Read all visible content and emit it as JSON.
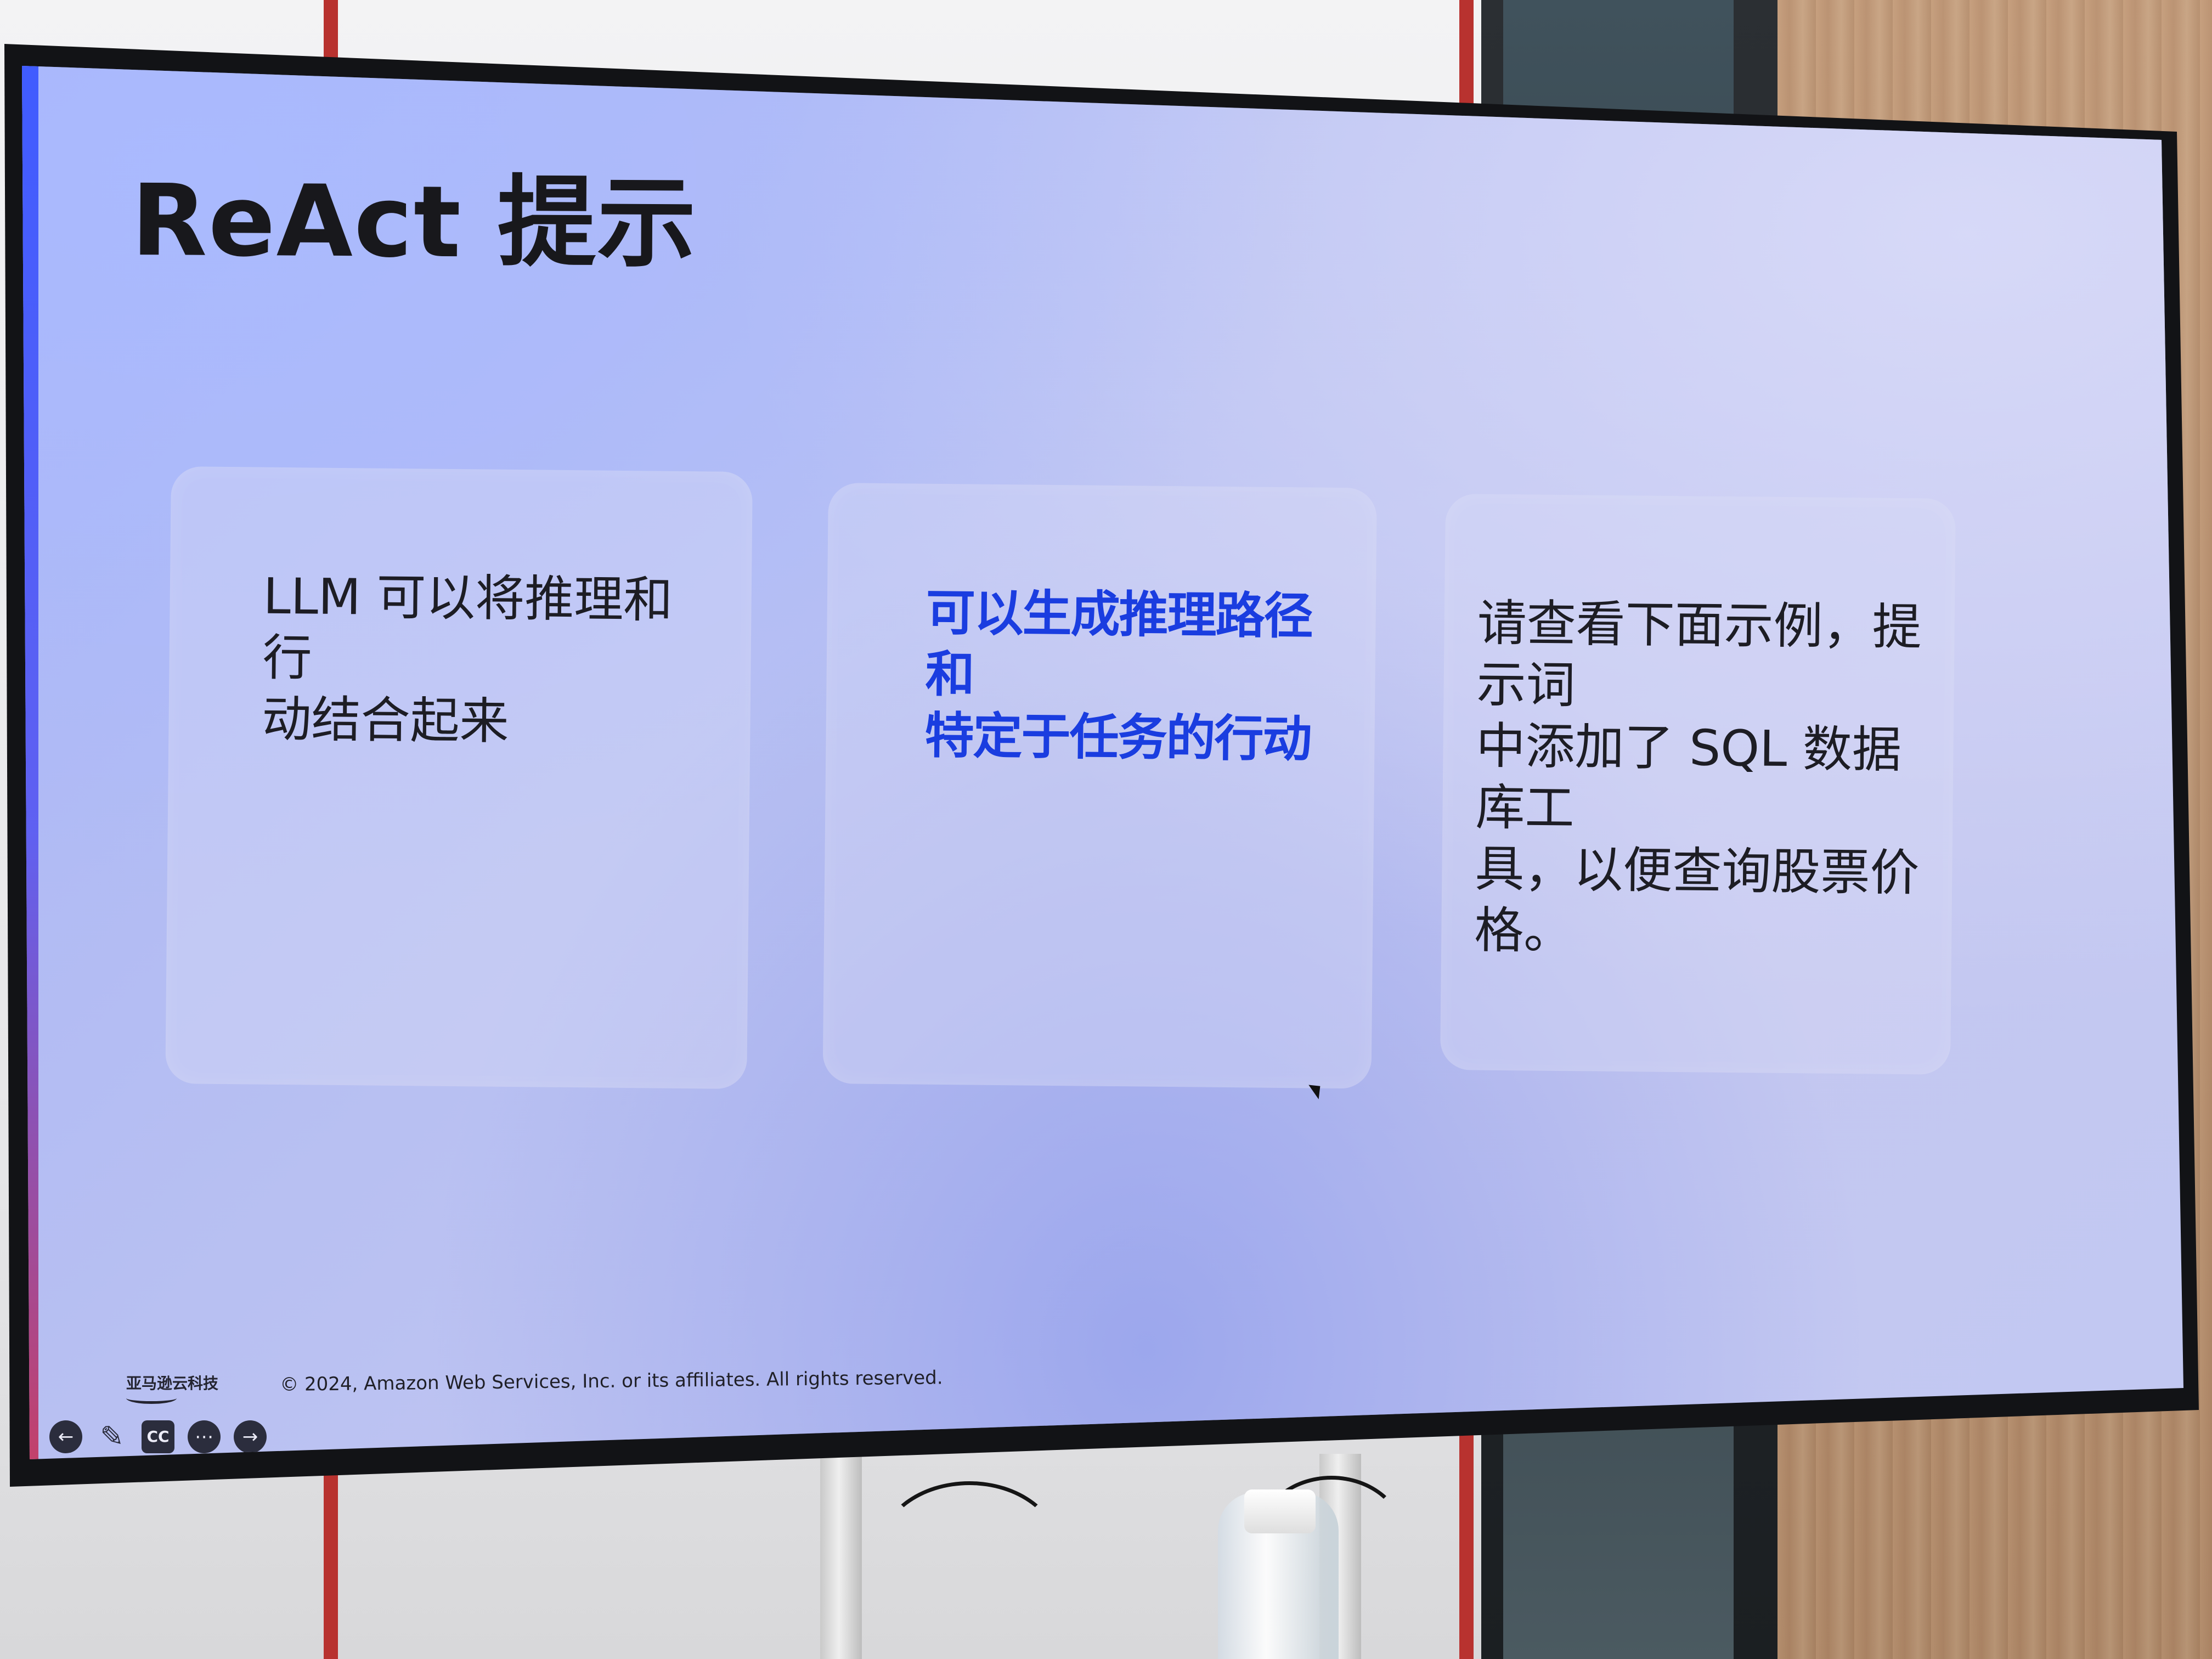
{
  "slide": {
    "title": "ReAct 提示",
    "cards": [
      {
        "text": "LLM 可以将推理和行\n动结合起来"
      },
      {
        "text": "可以生成推理路径和\n特定于任务的行动"
      },
      {
        "text": "请查看下面示例，提示词\n中添加了 SQL 数据库工\n具，以便查询股票价格。"
      }
    ]
  },
  "footer": {
    "brand_text": "亚马逊云科技",
    "copyright": "© 2024, Amazon Web Services, Inc. or its affiliates. All rights reserved."
  },
  "controls": [
    {
      "name": "back-button",
      "label": "←"
    },
    {
      "name": "pen-button",
      "label": "✎"
    },
    {
      "name": "captions-button",
      "label": "CC"
    },
    {
      "name": "more-button",
      "label": "⋯"
    },
    {
      "name": "next-button",
      "label": "→"
    }
  ],
  "colors": {
    "title": "#18181c",
    "card_highlight_text": "#1a3de0",
    "screen_gradient_start": "#a8b4f6",
    "screen_gradient_end": "#c2c8f2"
  }
}
